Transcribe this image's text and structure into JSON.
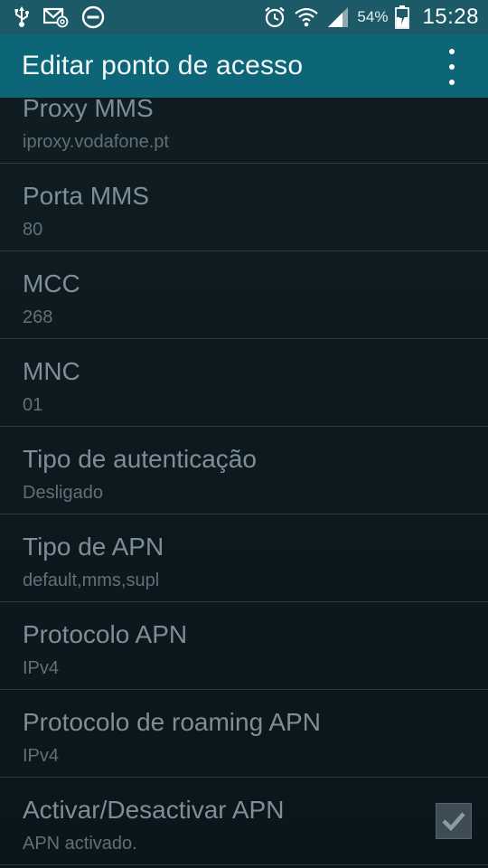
{
  "status_bar": {
    "icons_left": [
      "usb-icon",
      "mail-sync-icon",
      "do-not-disturb-icon"
    ],
    "icons_right": [
      "alarm-icon",
      "wifi-icon",
      "signal-icon",
      "battery-icon"
    ],
    "battery_percent": "54%",
    "time": "15:28"
  },
  "appbar": {
    "title": "Editar ponto de acesso",
    "menu_icon": "overflow-menu-icon"
  },
  "settings": [
    {
      "title": "Proxy MMS",
      "value": "iproxy.vodafone.pt"
    },
    {
      "title": "Porta MMS",
      "value": "80"
    },
    {
      "title": "MCC",
      "value": "268"
    },
    {
      "title": "MNC",
      "value": "01"
    },
    {
      "title": "Tipo de autenticação",
      "value": "Desligado"
    },
    {
      "title": "Tipo de APN",
      "value": "default,mms,supl"
    },
    {
      "title": "Protocolo APN",
      "value": "IPv4"
    },
    {
      "title": "Protocolo de roaming APN",
      "value": "IPv4"
    },
    {
      "title": "Activar/Desactivar APN",
      "value": "APN activado.",
      "checked": true
    }
  ],
  "colors": {
    "status_bar": "#1b5a66",
    "app_bar": "#0c6678",
    "background": "#0d1a20",
    "title_text": "#7d8f96",
    "value_text": "#5f7178"
  }
}
